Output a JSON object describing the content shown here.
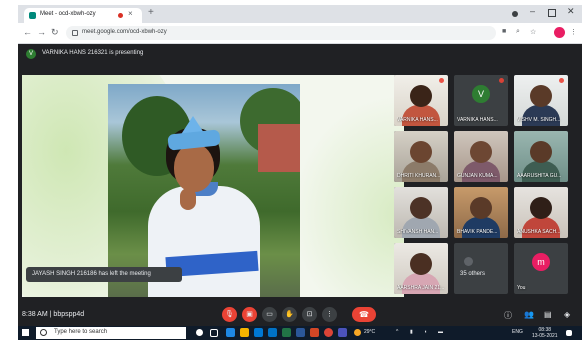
{
  "browser": {
    "tab_title": "Meet - ocd-xbwh-ozy",
    "new_tab_glyph": "+",
    "url": "meet.google.com/ocd-xbwh-ozy"
  },
  "presenting": {
    "avatar_letter": "V",
    "text": "VARNIKA HANS 216321 is presenting"
  },
  "toast": {
    "text": "JAYASH SINGH 216186 has left the meeting"
  },
  "participants": [
    {
      "name": "VARNIKA HANS...",
      "type": "video"
    },
    {
      "name": "VARNIKA HANS...",
      "type": "avatar",
      "letter": "V",
      "color": "#2e7d32"
    },
    {
      "name": "VISHV M. SINGH...",
      "type": "video"
    },
    {
      "name": "DHRITI KHURAN...",
      "type": "video"
    },
    {
      "name": "GUNJAN KUMA...",
      "type": "video"
    },
    {
      "name": "AAARUSHITA GU...",
      "type": "video"
    },
    {
      "name": "SHIVANSH HAN...",
      "type": "video"
    },
    {
      "name": "BHAVIK PANDE...",
      "type": "video"
    },
    {
      "name": "ANUSHKA SACH...",
      "type": "video"
    },
    {
      "name": "AARSHRA JAIN 21...",
      "type": "video"
    },
    {
      "name": "35 others",
      "type": "others"
    },
    {
      "name": "You",
      "type": "avatar",
      "letter": "m",
      "color": "#e91e63"
    }
  ],
  "meeting": {
    "time": "8:38 AM",
    "code": "bbpspp4d",
    "separator": "|"
  },
  "taskbar": {
    "search_placeholder": "Type here to search",
    "weather": "29°C",
    "lang": "ENG",
    "time": "08:38",
    "date": "13-05-2021"
  },
  "colors": {
    "accent_red": "#ea4335",
    "meet_dark": "#202124"
  }
}
